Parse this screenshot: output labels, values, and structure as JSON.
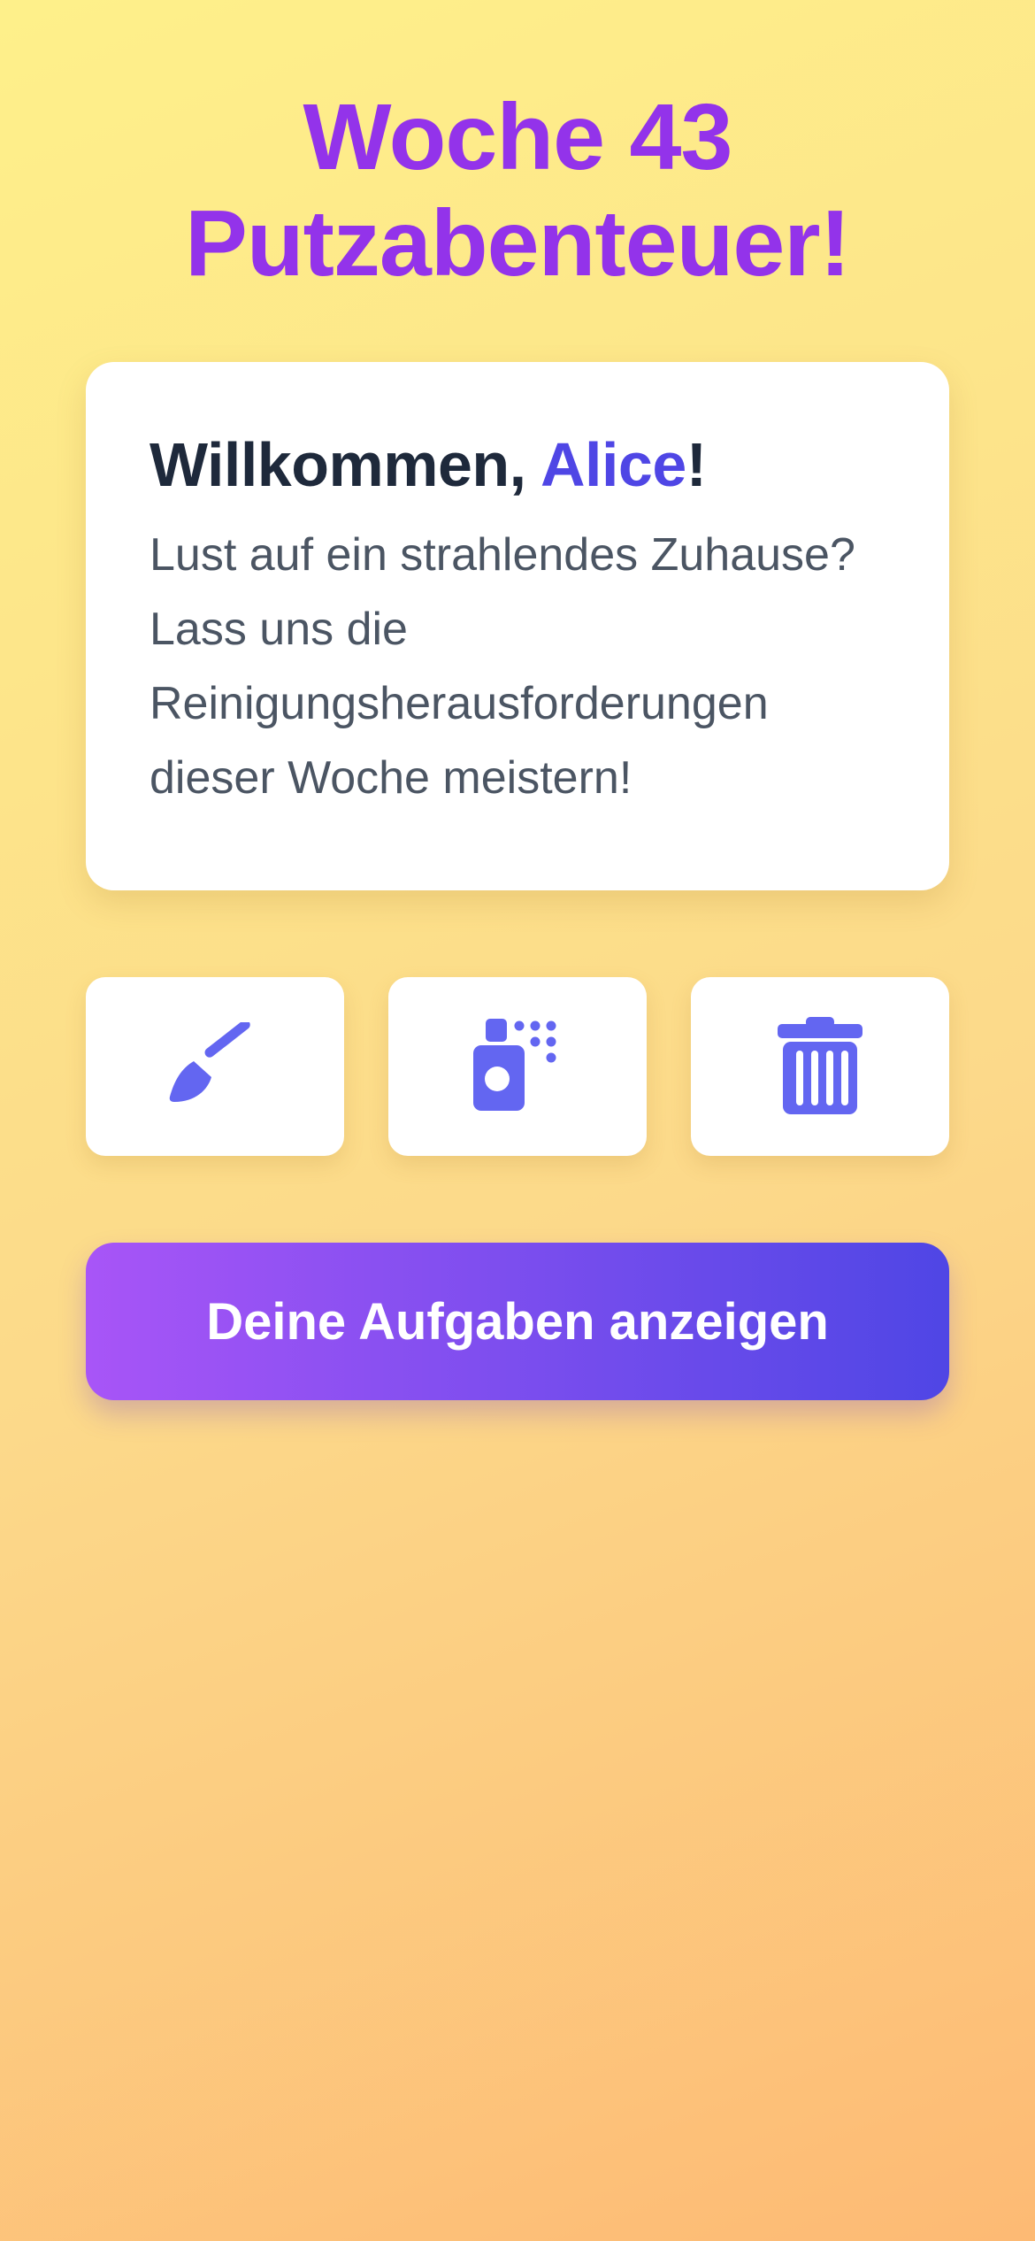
{
  "header": {
    "title_line1": "Woche 43",
    "title_line2": "Putzabenteuer!"
  },
  "welcome": {
    "greeting": "Willkommen, ",
    "name": "Alice",
    "punctuation": "!",
    "message": "Lust auf ein strahlendes Zuhause? Lass uns die Reinigungsherausforderungen dieser Woche meistern!"
  },
  "icons": [
    {
      "name": "broom-icon"
    },
    {
      "name": "spray-bottle-icon"
    },
    {
      "name": "trash-can-icon"
    }
  ],
  "cta": {
    "label": "Deine Aufgaben anzeigen"
  },
  "colors": {
    "title": "#9333EA",
    "accent": "#4F46E5",
    "icon": "#6366F1",
    "button_gradient_start": "#A855F7",
    "button_gradient_end": "#4F46E5",
    "heading_text": "#1E293B",
    "body_text": "#4B5563"
  }
}
